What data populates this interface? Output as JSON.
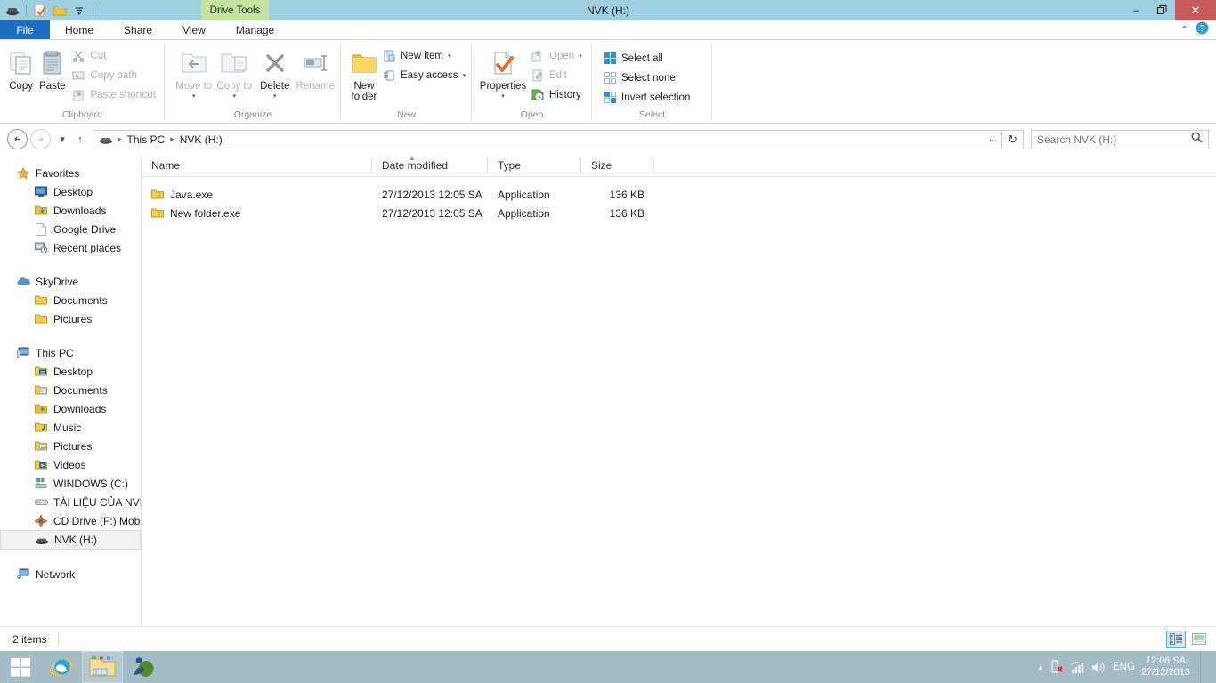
{
  "window": {
    "title": "NVK (H:)",
    "contextual_tab": "Drive Tools",
    "minimize_glyph": "–",
    "restore_glyph": "❐",
    "close_glyph": "✕"
  },
  "quick_access": [
    {
      "name": "drive-icon",
      "glyph": "drive"
    },
    {
      "name": "properties-icon",
      "glyph": "properties"
    },
    {
      "name": "new-folder-icon",
      "glyph": "folder"
    },
    {
      "name": "customize-qat-icon",
      "glyph": "☰"
    }
  ],
  "tabs": [
    {
      "label": "File",
      "id": "file",
      "active": false
    },
    {
      "label": "Home",
      "id": "home",
      "active": true
    },
    {
      "label": "Share",
      "id": "share",
      "active": false
    },
    {
      "label": "View",
      "id": "view",
      "active": false
    },
    {
      "label": "Manage",
      "id": "manage",
      "active": false
    }
  ],
  "tabstrip_right": {
    "collapse_ribbon": "⌃",
    "help": "?"
  },
  "ribbon": {
    "groups": [
      {
        "label": "Clipboard",
        "big_buttons": [
          {
            "label": "Copy",
            "icon": "copy-icon",
            "disabled": false
          },
          {
            "label": "Paste",
            "icon": "paste-icon",
            "disabled": false
          }
        ],
        "small_buttons": [
          {
            "label": "Cut",
            "icon": "cut-icon",
            "disabled": true
          },
          {
            "label": "Copy path",
            "icon": "copy-path-icon",
            "disabled": true
          },
          {
            "label": "Paste shortcut",
            "icon": "paste-shortcut-icon",
            "disabled": true
          }
        ]
      },
      {
        "label": "Organize",
        "big_buttons": [
          {
            "label": "Move to",
            "icon": "move-to-icon",
            "disabled": true,
            "caret": true
          },
          {
            "label": "Copy to",
            "icon": "copy-to-icon",
            "disabled": true,
            "caret": true
          },
          {
            "label": "Delete",
            "icon": "delete-icon",
            "disabled": false,
            "caret": true
          },
          {
            "label": "Rename",
            "icon": "rename-icon",
            "disabled": true
          }
        ],
        "small_buttons": []
      },
      {
        "label": "New",
        "big_buttons": [
          {
            "label": "New folder",
            "icon": "new-folder-icon",
            "disabled": false
          }
        ],
        "small_buttons": [
          {
            "label": "New item",
            "icon": "new-item-icon",
            "disabled": false,
            "caret": true
          },
          {
            "label": "Easy access",
            "icon": "easy-access-icon",
            "disabled": false,
            "caret": true
          }
        ]
      },
      {
        "label": "Open",
        "big_buttons": [
          {
            "label": "Properties",
            "icon": "properties-icon",
            "disabled": false,
            "caret": true
          }
        ],
        "small_buttons": [
          {
            "label": "Open",
            "icon": "open-icon",
            "disabled": true,
            "caret": true
          },
          {
            "label": "Edit",
            "icon": "edit-icon",
            "disabled": true
          },
          {
            "label": "History",
            "icon": "history-icon",
            "disabled": false
          }
        ]
      },
      {
        "label": "Select",
        "big_buttons": [],
        "small_buttons": [
          {
            "label": "Select all",
            "icon": "select-all-icon",
            "disabled": false
          },
          {
            "label": "Select none",
            "icon": "select-none-icon",
            "disabled": false
          },
          {
            "label": "Invert selection",
            "icon": "invert-selection-icon",
            "disabled": false
          }
        ]
      }
    ]
  },
  "addressbar": {
    "back_glyph": "←",
    "forward_glyph": "→",
    "recent_glyph": "▾",
    "up_glyph": "↑",
    "breadcrumbs": [
      "This PC",
      "NVK (H:)"
    ],
    "separator": "▸",
    "dropdown_glyph": "⌄",
    "refresh_glyph": "↻"
  },
  "search": {
    "placeholder": "Search NVK (H:)",
    "value": "",
    "icon_glyph": "⚲"
  },
  "navpane": {
    "sections": [
      {
        "root": {
          "label": "Favorites",
          "icon": "star-icon"
        },
        "children": [
          {
            "label": "Desktop",
            "icon": "desktop-icon"
          },
          {
            "label": "Downloads",
            "icon": "downloads-folder-icon"
          },
          {
            "label": "Google Drive",
            "icon": "document-icon"
          },
          {
            "label": "Recent places",
            "icon": "recent-places-icon"
          }
        ]
      },
      {
        "root": {
          "label": "SkyDrive",
          "icon": "cloud-icon"
        },
        "children": [
          {
            "label": "Documents",
            "icon": "folder-icon"
          },
          {
            "label": "Pictures",
            "icon": "folder-icon"
          }
        ]
      },
      {
        "root": {
          "label": "This PC",
          "icon": "computer-icon"
        },
        "children": [
          {
            "label": "Desktop",
            "icon": "desktop-folder-icon",
            "selected": false
          },
          {
            "label": "Documents",
            "icon": "documents-folder-icon",
            "selected": false
          },
          {
            "label": "Downloads",
            "icon": "downloads-folder-icon",
            "selected": false
          },
          {
            "label": "Music",
            "icon": "music-folder-icon",
            "selected": false
          },
          {
            "label": "Pictures",
            "icon": "pictures-folder-icon",
            "selected": false
          },
          {
            "label": "Videos",
            "icon": "videos-folder-icon",
            "selected": false
          },
          {
            "label": "WINDOWS (C:)",
            "icon": "system-drive-icon",
            "selected": false
          },
          {
            "label": "TÀI LIỆU CỦA NVK (I",
            "icon": "hard-drive-icon",
            "selected": false
          },
          {
            "label": "CD Drive (F:) Mobile",
            "icon": "cd-drive-icon",
            "selected": false
          },
          {
            "label": "NVK (H:)",
            "icon": "removable-drive-icon",
            "selected": true
          }
        ]
      },
      {
        "root": {
          "label": "Network",
          "icon": "network-icon"
        },
        "children": []
      }
    ]
  },
  "filelist": {
    "columns": [
      {
        "label": "Name",
        "key": "name",
        "sorted": true
      },
      {
        "label": "Date modified",
        "key": "date"
      },
      {
        "label": "Type",
        "key": "type"
      },
      {
        "label": "Size",
        "key": "size"
      }
    ],
    "sort_arrow": "▲",
    "rows": [
      {
        "name": "Java.exe",
        "date": "27/12/2013 12:05 SA",
        "type": "Application",
        "size": "136 KB",
        "icon": "folder-icon"
      },
      {
        "name": "New folder.exe",
        "date": "27/12/2013 12:05 SA",
        "type": "Application",
        "size": "136 KB",
        "icon": "folder-icon"
      }
    ]
  },
  "statusbar": {
    "item_count": "2 items",
    "views": [
      {
        "name": "details-view-button",
        "selected": true
      },
      {
        "name": "large-icons-view-button",
        "selected": false
      }
    ]
  },
  "taskbar": {
    "start": "start-button",
    "items": [
      {
        "name": "internet-explorer-button",
        "active": false
      },
      {
        "name": "file-explorer-button",
        "active": true
      },
      {
        "name": "media-app-button",
        "active": false
      }
    ],
    "tray": {
      "overflow_glyph": "▴",
      "icons": [
        "network-disconnected-icon",
        "wifi-icon",
        "volume-icon"
      ],
      "language": "ENG",
      "time": "12:06 SA",
      "date": "27/12/2013"
    }
  },
  "colors": {
    "titlebar": "#9fd0e0",
    "file_tab": "#1a6fc4",
    "contextual_tab": "#c3e5a0",
    "close_button": "#c75b5b",
    "taskbar": "#a3bcc6",
    "selection": "#f2f2f2"
  }
}
